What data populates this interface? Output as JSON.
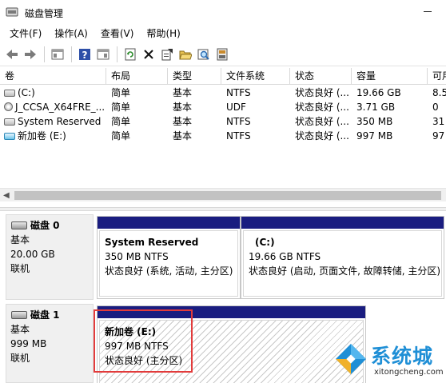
{
  "window": {
    "title": "磁盘管理"
  },
  "menu": [
    "文件(F)",
    "操作(A)",
    "查看(V)",
    "帮助(H)"
  ],
  "toolbar": [
    "back-arrow-icon",
    "forward-arrow-icon",
    "properties-panel-icon",
    "help-icon",
    "panel-icon",
    "refresh-icon",
    "delete-x-icon",
    "settings-icon",
    "folder-open-icon",
    "search-icon",
    "disk-properties-icon"
  ],
  "table": {
    "columns": [
      "卷",
      "布局",
      "类型",
      "文件系统",
      "状态",
      "容量",
      "可用"
    ],
    "rows": [
      {
        "volume": "(C:)",
        "layout": "简单",
        "type": "基本",
        "fs": "NTFS",
        "status": "状态良好 (...",
        "capacity": "19.66 GB",
        "free": "8.5"
      },
      {
        "volume": "J_CCSA_X64FRE_...",
        "layout": "简单",
        "type": "基本",
        "fs": "UDF",
        "status": "状态良好 (...",
        "capacity": "3.71 GB",
        "free": "0"
      },
      {
        "volume": "System Reserved",
        "layout": "简单",
        "type": "基本",
        "fs": "NTFS",
        "status": "状态良好 (...",
        "capacity": "350 MB",
        "free": "31"
      },
      {
        "volume": "新加卷 (E:)",
        "layout": "简单",
        "type": "基本",
        "fs": "NTFS",
        "status": "状态良好 (...",
        "capacity": "997 MB",
        "free": "97"
      }
    ]
  },
  "disks": [
    {
      "name": "磁盘 0",
      "kind": "基本",
      "size": "20.00 GB",
      "state": "联机",
      "partitions": [
        {
          "name": "System Reserved",
          "detail": "350 MB NTFS",
          "status": "状态良好 (系统, 活动, 主分区)"
        },
        {
          "name": "(C:)",
          "detail": "19.66 GB NTFS",
          "status": "状态良好 (启动, 页面文件, 故障转储, 主分区)"
        }
      ]
    },
    {
      "name": "磁盘 1",
      "kind": "基本",
      "size": "999 MB",
      "state": "联机",
      "partitions": [
        {
          "name": "新加卷 (E:)",
          "detail": "997 MB NTFS",
          "status": "状态良好 (主分区)"
        }
      ]
    }
  ],
  "watermark": {
    "text": "系统城",
    "url": "xitongcheng.com"
  },
  "colors": {
    "partition_bar": "#1a1d80",
    "highlight_box": "#e23b3b",
    "watermark": "#1f8fd6"
  }
}
